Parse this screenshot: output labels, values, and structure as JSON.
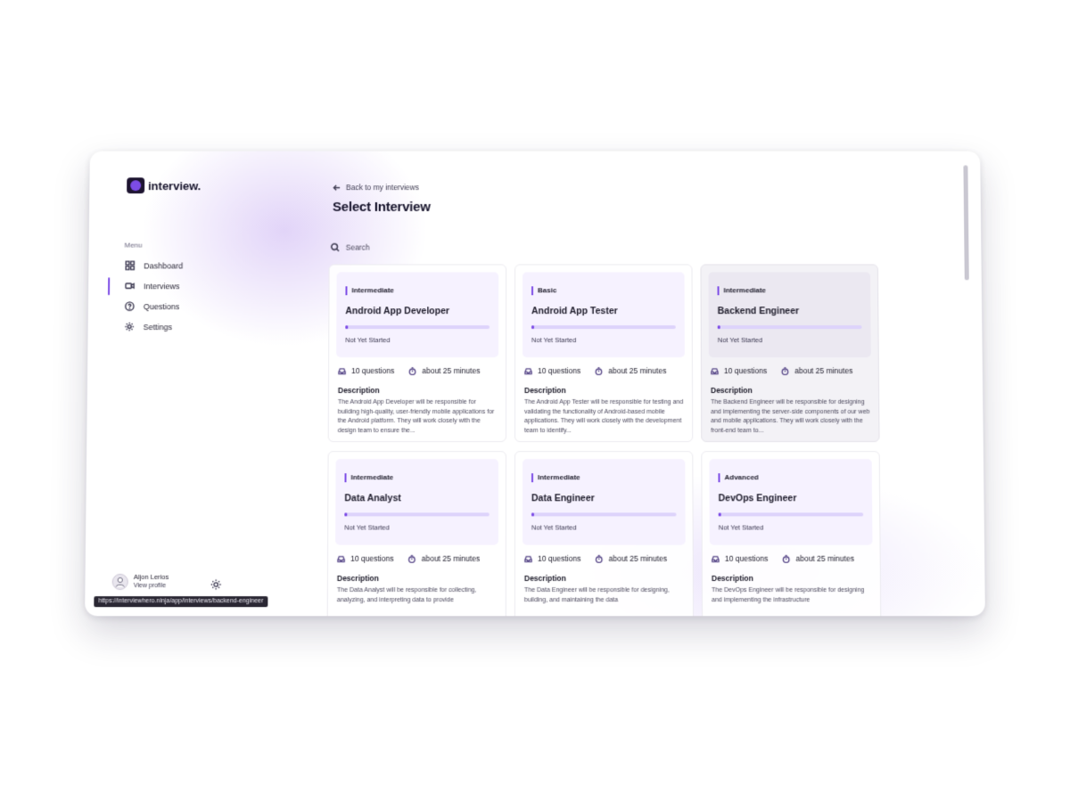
{
  "brand": {
    "name": "interview."
  },
  "sidebar": {
    "menu_label": "Menu",
    "items": [
      {
        "label": "Dashboard",
        "icon": "grid-icon"
      },
      {
        "label": "Interviews",
        "icon": "video-icon",
        "active": true
      },
      {
        "label": "Questions",
        "icon": "question-icon"
      },
      {
        "label": "Settings",
        "icon": "gear-icon"
      }
    ],
    "profile": {
      "name": "Aljon Lerios",
      "link": "View profile"
    }
  },
  "status_url": "https://interviewhero.ninja/app/interviews/backend-engineer",
  "main": {
    "back_label": "Back to my interviews",
    "title": "Select Interview",
    "search_placeholder": "Search"
  },
  "cards": [
    {
      "level": "Intermediate",
      "title": "Android App Developer",
      "status": "Not Yet Started",
      "progress": 0.02,
      "questions": "10 questions",
      "duration": "about 25 minutes",
      "desc_label": "Description",
      "description": "The Android App Developer will be responsible for building high-quality, user-friendly mobile applications for the Android platform. They will work closely with the design team to ensure the..."
    },
    {
      "level": "Basic",
      "title": "Android App Tester",
      "status": "Not Yet Started",
      "progress": 0.02,
      "questions": "10 questions",
      "duration": "about 25 minutes",
      "desc_label": "Description",
      "description": "The Android App Tester will be responsible for testing and validating the functionality of Android-based mobile applications. They will work closely with the development team to identify..."
    },
    {
      "level": "Intermediate",
      "title": "Backend Engineer",
      "status": "Not Yet Started",
      "progress": 0.02,
      "questions": "10 questions",
      "duration": "about 25 minutes",
      "desc_label": "Description",
      "description": "The Backend Engineer will be responsible for designing and implementing the server-side components of our web and mobile applications. They will work closely with the front-end team to..."
    },
    {
      "level": "Intermediate",
      "title": "Data Analyst",
      "status": "Not Yet Started",
      "progress": 0.02,
      "questions": "10 questions",
      "duration": "about 25 minutes",
      "desc_label": "Description",
      "description": "The Data Analyst will be responsible for collecting, analyzing, and interpreting data to provide"
    },
    {
      "level": "Intermediate",
      "title": "Data Engineer",
      "status": "Not Yet Started",
      "progress": 0.02,
      "questions": "10 questions",
      "duration": "about 25 minutes",
      "desc_label": "Description",
      "description": "The Data Engineer will be responsible for designing, building, and maintaining the data"
    },
    {
      "level": "Advanced",
      "title": "DevOps Engineer",
      "status": "Not Yet Started",
      "progress": 0.02,
      "questions": "10 questions",
      "duration": "about 25 minutes",
      "desc_label": "Description",
      "description": "The DevOps Engineer will be responsible for designing and implementing the infrastructure"
    }
  ],
  "colors": {
    "accent": "#7c4ce6",
    "card_head": "#f6f2ff",
    "progress_track": "#ddd3fb"
  }
}
